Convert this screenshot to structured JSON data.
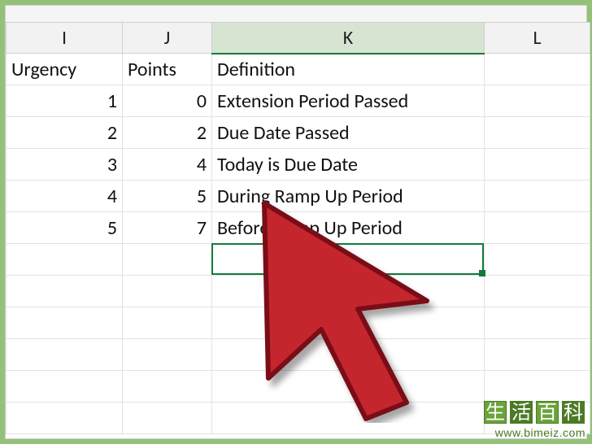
{
  "columns": {
    "I": "I",
    "J": "J",
    "K": "K",
    "L": "L"
  },
  "headers": {
    "urgency": "Urgency",
    "points": "Points",
    "definition": "Definition"
  },
  "rows": [
    {
      "urgency": "1",
      "points": "0",
      "definition": "Extension Period Passed"
    },
    {
      "urgency": "2",
      "points": "2",
      "definition": "Due Date Passed"
    },
    {
      "urgency": "3",
      "points": "4",
      "definition": "Today is Due Date"
    },
    {
      "urgency": "4",
      "points": "5",
      "definition": "During Ramp Up Period"
    },
    {
      "urgency": "5",
      "points": "7",
      "definition": "Before Ramp Up Period"
    }
  ],
  "selected": {
    "cell": "K7",
    "column": "K"
  },
  "watermark": {
    "c1": "生",
    "c2": "活",
    "c3": "百",
    "c4": "科",
    "url": "www.bimeiz.com"
  },
  "cursor_color": "#c5262f",
  "accent_color": "#137a3a",
  "chart_data": {
    "type": "table",
    "columns": [
      "Urgency",
      "Points",
      "Definition"
    ],
    "rows": [
      [
        1,
        0,
        "Extension Period Passed"
      ],
      [
        2,
        2,
        "Due Date Passed"
      ],
      [
        3,
        4,
        "Today is Due Date"
      ],
      [
        4,
        5,
        "During Ramp Up Period"
      ],
      [
        5,
        7,
        "Before Ramp Up Period"
      ]
    ]
  }
}
